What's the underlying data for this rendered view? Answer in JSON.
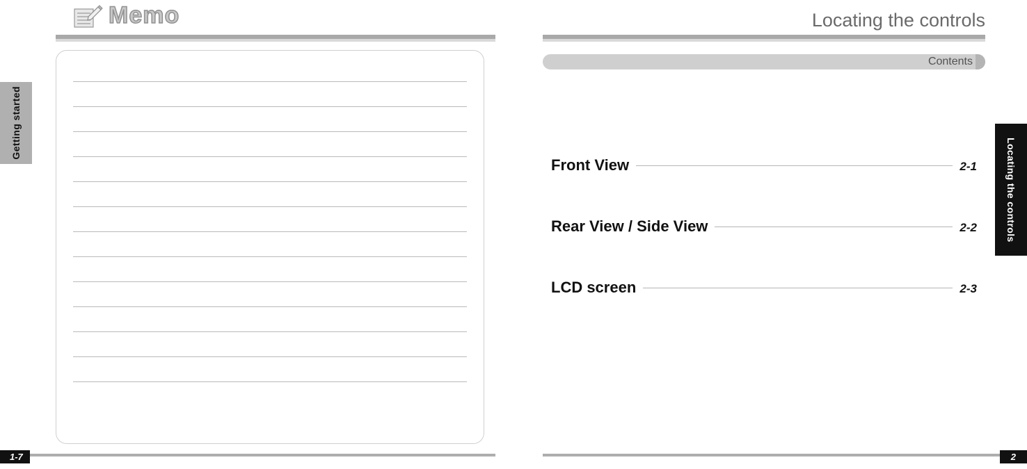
{
  "left_page": {
    "side_tab": "Getting started",
    "memo_title": "Memo",
    "page_number": "1-7"
  },
  "right_page": {
    "chapter_title": "Locating the controls",
    "contents_label": "Contents",
    "side_tab": "Locating the controls",
    "toc": [
      {
        "label": "Front View",
        "page": "2-1"
      },
      {
        "label": "Rear View / Side View",
        "page": "2-2"
      },
      {
        "label": "LCD screen",
        "page": "2-3"
      }
    ],
    "page_number": "2"
  }
}
